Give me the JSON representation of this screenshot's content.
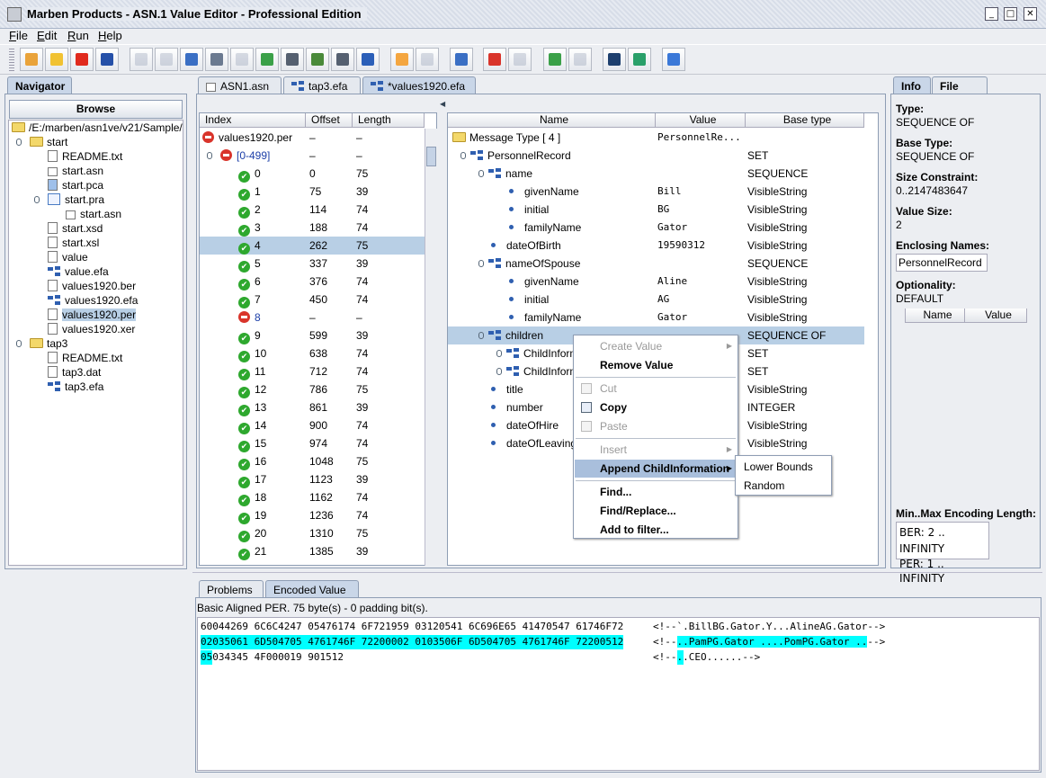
{
  "window": {
    "title": "Marben Products - ASN.1 Value Editor - Professional Edition"
  },
  "menu": [
    "File",
    "Edit",
    "Run",
    "Help"
  ],
  "toolbar": [
    {
      "icon": "new-file-icon",
      "color": "#e9a33a",
      "enabled": true
    },
    {
      "icon": "open-folder-icon",
      "color": "#f1c232",
      "enabled": true
    },
    {
      "icon": "close-red-x-icon",
      "color": "#e02a1d",
      "enabled": true
    },
    {
      "icon": "save-disk-icon",
      "color": "#2550a8",
      "enabled": true
    },
    {
      "icon": "undo-icon",
      "color": "#8090a8",
      "enabled": false
    },
    {
      "icon": "redo-icon",
      "color": "#8090a8",
      "enabled": false
    },
    {
      "icon": "cut-scissors-icon",
      "color": "#3a6fc4",
      "enabled": true
    },
    {
      "icon": "copy-icon",
      "color": "#6b7a90",
      "enabled": true
    },
    {
      "icon": "paste-icon",
      "color": "#8090a8",
      "enabled": false
    },
    {
      "icon": "import-icon",
      "color": "#3aa048",
      "enabled": true
    },
    {
      "icon": "find-binoculars-icon",
      "color": "#556070",
      "enabled": true
    },
    {
      "icon": "find-replace-icon",
      "color": "#4a8a3a",
      "enabled": true
    },
    {
      "icon": "filter-binoculars-icon",
      "color": "#556070",
      "enabled": true
    },
    {
      "icon": "windows-icon",
      "color": "#2b5fb8",
      "enabled": true
    },
    {
      "icon": "window-icon",
      "color": "#f4a640",
      "enabled": true
    },
    {
      "icon": "settings-gear-icon",
      "color": "#8090a8",
      "enabled": false
    },
    {
      "icon": "tree-structure-icon",
      "color": "#3a6fc4",
      "enabled": true
    },
    {
      "icon": "shapes-icon",
      "color": "#d9342b",
      "enabled": true
    },
    {
      "icon": "shapes-disabled-icon",
      "color": "#8090a8",
      "enabled": false
    },
    {
      "icon": "database-import-icon",
      "color": "#3aa048",
      "enabled": true
    },
    {
      "icon": "database-icon",
      "color": "#8090a8",
      "enabled": false
    },
    {
      "icon": "monitor-icon",
      "color": "#1d3f6e",
      "enabled": true
    },
    {
      "icon": "search-globe-icon",
      "color": "#2aa06a",
      "enabled": true
    },
    {
      "icon": "help-icon",
      "color": "#3a78d8",
      "enabled": true
    }
  ],
  "navigator": {
    "tab": "Navigator",
    "browse": "Browse",
    "items": [
      {
        "label": "/E:/marben/asn1ve/v21/Sample/",
        "icon": "folder",
        "level": 0
      },
      {
        "label": "start",
        "icon": "folder",
        "level": 1,
        "expander": true
      },
      {
        "label": "README.txt",
        "icon": "file",
        "level": 2
      },
      {
        "label": "start.asn",
        "icon": "asn",
        "level": 2
      },
      {
        "label": "start.pca",
        "icon": "pca",
        "level": 2
      },
      {
        "label": "start.pra",
        "icon": "pra",
        "level": 2,
        "expander": true
      },
      {
        "label": "start.asn",
        "icon": "asn",
        "level": 3
      },
      {
        "label": "start.xsd",
        "icon": "file",
        "level": 2
      },
      {
        "label": "start.xsl",
        "icon": "file",
        "level": 2
      },
      {
        "label": "value",
        "icon": "file",
        "level": 2
      },
      {
        "label": "value.efa",
        "icon": "efa",
        "level": 2
      },
      {
        "label": "values1920.ber",
        "icon": "file",
        "level": 2
      },
      {
        "label": "values1920.efa",
        "icon": "efa",
        "level": 2
      },
      {
        "label": "values1920.per",
        "icon": "file",
        "level": 2,
        "selected": true
      },
      {
        "label": "values1920.xer",
        "icon": "file",
        "level": 2
      },
      {
        "label": "tap3",
        "icon": "folder",
        "level": 1,
        "expander": true
      },
      {
        "label": "README.txt",
        "icon": "file",
        "level": 2
      },
      {
        "label": "tap3.dat",
        "icon": "file",
        "level": 2
      },
      {
        "label": "tap3.efa",
        "icon": "efa",
        "level": 2
      }
    ]
  },
  "editor_tabs": [
    {
      "label": "ASN1.asn",
      "icon": "asn"
    },
    {
      "label": "tap3.efa",
      "icon": "efa"
    },
    {
      "label": "*values1920.efa",
      "icon": "efa",
      "active": true
    }
  ],
  "index_table": {
    "headers": [
      "Index",
      "Offset",
      "Length"
    ],
    "rows": [
      {
        "index": "values1920.per",
        "offset": "–",
        "length": "–",
        "status": "error",
        "level": 0
      },
      {
        "index": "[0-499]",
        "offset": "–",
        "length": "–",
        "status": "error",
        "level": 1
      },
      {
        "index": "0",
        "offset": "0",
        "length": "75",
        "status": "ok",
        "level": 2
      },
      {
        "index": "1",
        "offset": "75",
        "length": "39",
        "status": "ok",
        "level": 2
      },
      {
        "index": "2",
        "offset": "114",
        "length": "74",
        "status": "ok",
        "level": 2
      },
      {
        "index": "3",
        "offset": "188",
        "length": "74",
        "status": "ok",
        "level": 2
      },
      {
        "index": "4",
        "offset": "262",
        "length": "75",
        "status": "ok",
        "level": 2,
        "selected": true
      },
      {
        "index": "5",
        "offset": "337",
        "length": "39",
        "status": "ok",
        "level": 2
      },
      {
        "index": "6",
        "offset": "376",
        "length": "74",
        "status": "ok",
        "level": 2
      },
      {
        "index": "7",
        "offset": "450",
        "length": "74",
        "status": "ok",
        "level": 2
      },
      {
        "index": "8",
        "offset": "–",
        "length": "–",
        "status": "error",
        "level": 2
      },
      {
        "index": "9",
        "offset": "599",
        "length": "39",
        "status": "ok",
        "level": 2
      },
      {
        "index": "10",
        "offset": "638",
        "length": "74",
        "status": "ok",
        "level": 2
      },
      {
        "index": "11",
        "offset": "712",
        "length": "74",
        "status": "ok",
        "level": 2
      },
      {
        "index": "12",
        "offset": "786",
        "length": "75",
        "status": "ok",
        "level": 2
      },
      {
        "index": "13",
        "offset": "861",
        "length": "39",
        "status": "ok",
        "level": 2
      },
      {
        "index": "14",
        "offset": "900",
        "length": "74",
        "status": "ok",
        "level": 2
      },
      {
        "index": "15",
        "offset": "974",
        "length": "74",
        "status": "ok",
        "level": 2
      },
      {
        "index": "16",
        "offset": "1048",
        "length": "75",
        "status": "ok",
        "level": 2
      },
      {
        "index": "17",
        "offset": "1123",
        "length": "39",
        "status": "ok",
        "level": 2
      },
      {
        "index": "18",
        "offset": "1162",
        "length": "74",
        "status": "ok",
        "level": 2
      },
      {
        "index": "19",
        "offset": "1236",
        "length": "74",
        "status": "ok",
        "level": 2
      },
      {
        "index": "20",
        "offset": "1310",
        "length": "75",
        "status": "ok",
        "level": 2
      },
      {
        "index": "21",
        "offset": "1385",
        "length": "39",
        "status": "ok",
        "level": 2
      }
    ]
  },
  "value_tree": {
    "headers": [
      "Name",
      "Value",
      "Base type"
    ],
    "rows": [
      {
        "name": "Message Type [ 4 ]",
        "value": "PersonnelRe...",
        "type": "",
        "icon": "folder",
        "level": 0
      },
      {
        "name": "PersonnelRecord",
        "value": "",
        "type": "SET",
        "icon": "efa",
        "level": 1,
        "expander": true
      },
      {
        "name": "name",
        "value": "",
        "type": "SEQUENCE",
        "icon": "efa",
        "level": 2,
        "expander": true
      },
      {
        "name": "givenName",
        "value": "Bill",
        "type": "VisibleString",
        "icon": "dot",
        "level": 3
      },
      {
        "name": "initial",
        "value": "BG",
        "type": "VisibleString",
        "icon": "dot",
        "level": 3
      },
      {
        "name": "familyName",
        "value": "Gator",
        "type": "VisibleString",
        "icon": "dot",
        "level": 3
      },
      {
        "name": "dateOfBirth",
        "value": "19590312",
        "type": "VisibleString",
        "icon": "dot",
        "level": 2
      },
      {
        "name": "nameOfSpouse",
        "value": "",
        "type": "SEQUENCE",
        "icon": "efa",
        "level": 2,
        "expander": true
      },
      {
        "name": "givenName",
        "value": "Aline",
        "type": "VisibleString",
        "icon": "dot",
        "level": 3
      },
      {
        "name": "initial",
        "value": "AG",
        "type": "VisibleString",
        "icon": "dot",
        "level": 3
      },
      {
        "name": "familyName",
        "value": "Gator",
        "type": "VisibleString",
        "icon": "dot",
        "level": 3
      },
      {
        "name": "children",
        "value": "",
        "type": "SEQUENCE OF",
        "icon": "efa",
        "level": 2,
        "expander": true,
        "selected": true
      },
      {
        "name": "ChildInform",
        "value": "",
        "type": "SET",
        "icon": "efa",
        "level": 3,
        "expander": true
      },
      {
        "name": "ChildInform",
        "value": "",
        "type": "SET",
        "icon": "efa",
        "level": 3,
        "expander": true
      },
      {
        "name": "title",
        "value": "",
        "type": "VisibleString",
        "icon": "dot",
        "level": 2
      },
      {
        "name": "number",
        "value": "",
        "type": "INTEGER",
        "icon": "dot",
        "level": 2
      },
      {
        "name": "dateOfHire",
        "value": "",
        "type": "VisibleString",
        "icon": "dot",
        "level": 2
      },
      {
        "name": "dateOfLeaving",
        "value": "",
        "type": "VisibleString",
        "icon": "dot",
        "level": 2
      }
    ]
  },
  "context_menu": [
    {
      "label": "Create Value",
      "enabled": false,
      "submenu": true
    },
    {
      "label": "Remove Value",
      "enabled": true
    },
    {
      "sep": true
    },
    {
      "label": "Cut",
      "enabled": false,
      "icon": "cut-icon"
    },
    {
      "label": "Copy",
      "enabled": true,
      "icon": "copy-icon"
    },
    {
      "label": "Paste",
      "enabled": false,
      "icon": "paste-icon"
    },
    {
      "sep": true
    },
    {
      "label": "Insert",
      "enabled": false,
      "submenu": true
    },
    {
      "label": "Append ChildInformation",
      "enabled": true,
      "submenu": true,
      "highlighted": true
    },
    {
      "sep": true
    },
    {
      "label": "Find...",
      "enabled": true
    },
    {
      "label": "Find/Replace...",
      "enabled": true
    },
    {
      "label": "Add to filter...",
      "enabled": true
    }
  ],
  "submenu": [
    "Lower Bounds",
    "Random"
  ],
  "info": {
    "tabs": [
      "Info",
      "File Info"
    ],
    "type_label": "Type:",
    "type": "SEQUENCE OF",
    "base_type_label": "Base Type:",
    "base_type": "SEQUENCE OF",
    "size_label": "Size Constraint:",
    "size": "0..2147483647",
    "value_size_label": "Value Size:",
    "value_size": "2",
    "enclosing_label": "Enclosing Names:",
    "enclosing": "PersonnelRecord",
    "optionality_label": "Optionality:",
    "optionality": "DEFAULT",
    "table_headers": [
      "Name",
      "Value"
    ],
    "minmax_label": "Min..Max Encoding Length:",
    "ber": "BER: 2 .. INFINITY",
    "per": "PER: 1 .. INFINITY"
  },
  "bottom": {
    "tabs": [
      "Problems",
      "Encoded Value"
    ],
    "summary": "Basic Aligned PER. 75 byte(s) - 0 padding bit(s).",
    "lines": [
      {
        "hex": "60044269 6C6C4247 05476174 6F721959 03120541 6C696E65 41470547 61746F72",
        "ascii": "<!--`.BillBG.Gator.Y...AlineAG.Gator-->"
      },
      {
        "hex": "02035061 6D504705 4761746F 72200002 0103506F 6D504705 4761746F 72200512",
        "ascii": "<!--..PamPG.Gator ....PomPG.Gator ..-->"
      },
      {
        "hex": "05034345 4F000019 901512",
        "ascii": "<!--..CEO......-->"
      }
    ],
    "highlight_color": "#00ffff"
  }
}
